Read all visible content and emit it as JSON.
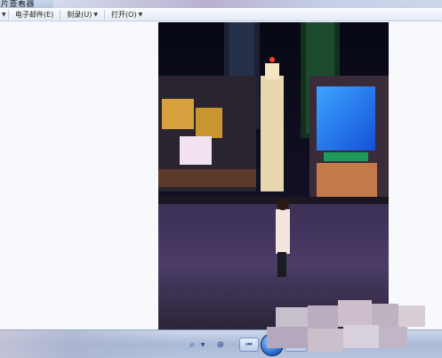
{
  "window": {
    "title": "片查看器"
  },
  "menu": [
    {
      "label": ""
    },
    {
      "label": "电子邮件(E)"
    },
    {
      "label": "刻录(U)"
    },
    {
      "label": "打开(O)"
    }
  ],
  "icons": {
    "zoom": "magnifier-icon",
    "fit": "fit-window-icon",
    "prev": "previous-icon",
    "play": "slideshow-icon",
    "next": "next-icon",
    "rotate_ccw": "rotate-left-icon",
    "rotate_cw": "rotate-right-icon",
    "delete": "delete-icon"
  },
  "colors": {
    "menubar": "#e8eef8",
    "delete": "#c8262a",
    "accent": "#2b6fd0"
  }
}
